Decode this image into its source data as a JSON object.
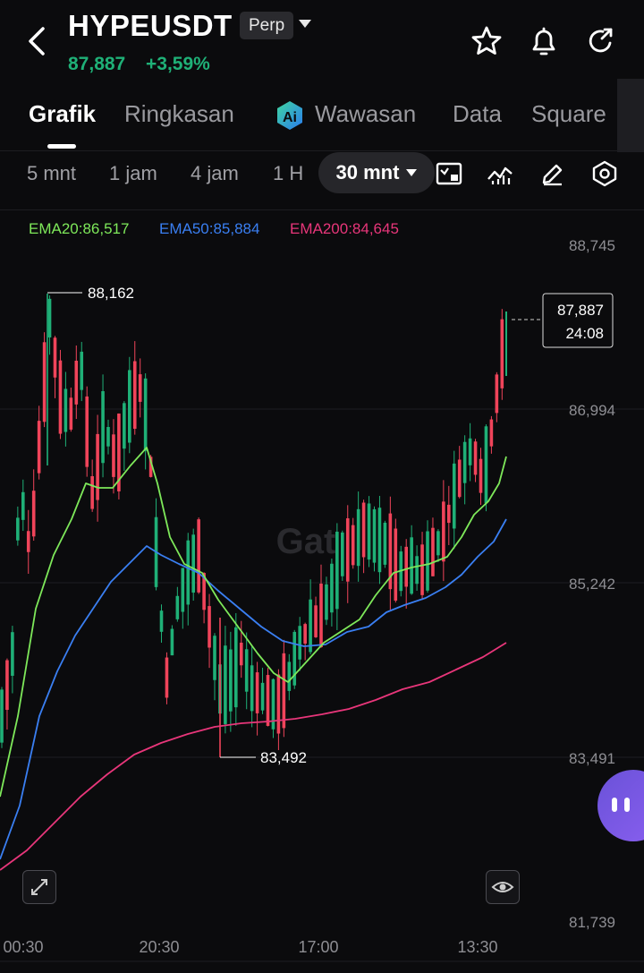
{
  "header": {
    "symbol": "HYPEUSDT",
    "badge": "Perp",
    "price": "87,887",
    "change": "+3,59%"
  },
  "tabs": [
    "Grafik",
    "Ringkasan",
    "Wawasan",
    "Data",
    "Square"
  ],
  "intervals": [
    "5 mnt",
    "1 jam",
    "4 jam",
    "1 H",
    "30 mnt"
  ],
  "indicators": {
    "ema20": "EMA20:86,517",
    "ema50": "EMA50:85,884",
    "ema200": "EMA200:84,645"
  },
  "colors": {
    "up": "#1fb077",
    "down": "#f0445a",
    "ema20": "#7ee85a",
    "ema50": "#3a7ff2",
    "ema200": "#e8367a"
  },
  "chart_data": {
    "type": "candlestick",
    "price_axis": [
      "88,745",
      "86,994",
      "85,242",
      "83,491",
      "81,739"
    ],
    "time_axis": [
      "00:30",
      "20:30",
      "17:00",
      "13:30"
    ],
    "high_label": "88,162",
    "low_label": "83,492",
    "last_price": "87,887",
    "countdown": "24:08",
    "watermark": "Gat"
  }
}
